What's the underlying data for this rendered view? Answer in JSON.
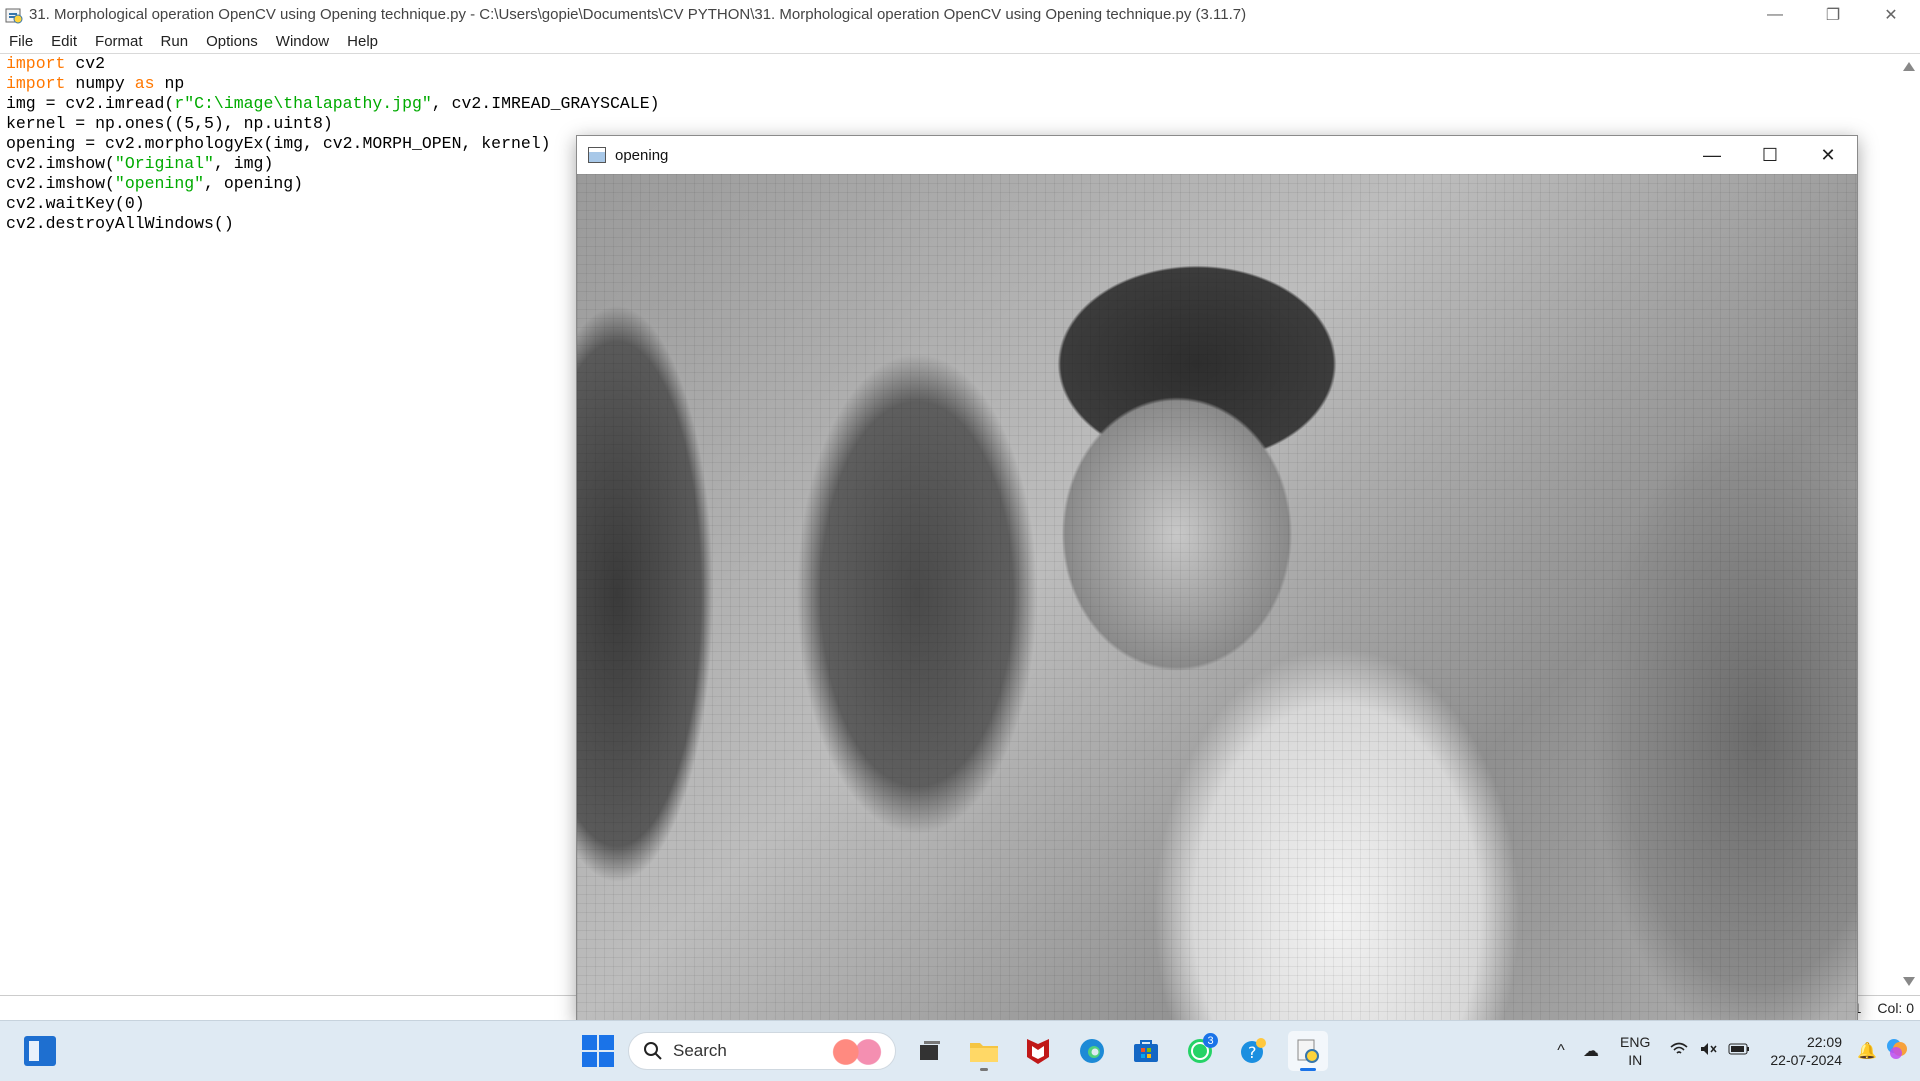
{
  "window": {
    "title": "31. Morphological operation OpenCV using Opening technique.py - C:\\Users\\gopie\\Documents\\CV PYTHON\\31. Morphological operation OpenCV using Opening technique.py (3.11.7)",
    "minimize": "—",
    "restore": "❐",
    "close": "✕"
  },
  "menu": [
    "File",
    "Edit",
    "Format",
    "Run",
    "Options",
    "Window",
    "Help"
  ],
  "code": [
    {
      "k": "import",
      "r": " cv2"
    },
    {
      "k": "import",
      "r": " numpy ",
      "k2": "as",
      "r2": " np"
    },
    {
      "a": "img = cv2.imread(",
      "s": "r\"C:\\image\\thalapathy.jpg\"",
      "b": ", cv2.IMREAD_GRAYSCALE)"
    },
    {
      "a": "kernel = np.ones((5,5), np.uint8)"
    },
    {
      "a": "opening = cv2.morphologyEx(img, cv2.MORPH_OPEN, kernel)"
    },
    {
      "a": "cv2.imshow(",
      "s": "\"Original\"",
      "b": ", img)"
    },
    {
      "a": "cv2.imshow(",
      "s": "\"opening\"",
      "b": ", opening)"
    },
    {
      "a": "cv2.waitKey(0)"
    },
    {
      "a": "cv2.destroyAllWindows()"
    }
  ],
  "status": {
    "line": "1",
    "col": "Col: 0"
  },
  "cv_window": {
    "title": "opening",
    "minimize": "—",
    "maximize": "☐",
    "close": "✕"
  },
  "taskbar": {
    "search_label": "Search",
    "whatsapp_badge": "3",
    "apps": [
      "start-icon",
      "task-view-icon",
      "file-explorer-icon",
      "mcafee-icon",
      "edge-icon",
      "store-icon",
      "whatsapp-icon",
      "help-icon",
      "python-idle-icon"
    ],
    "lang_top": "ENG",
    "lang_bottom": "IN",
    "time": "22:09",
    "date": "22-07-2024"
  }
}
